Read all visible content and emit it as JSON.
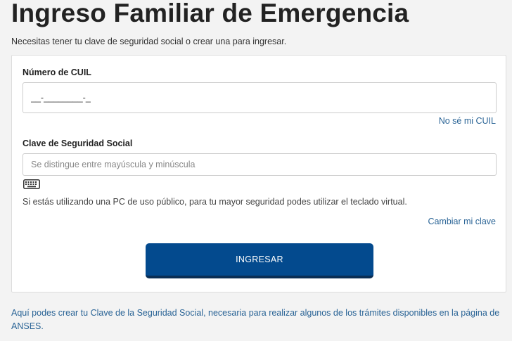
{
  "header": {
    "title": "Ingreso Familiar de Emergencia",
    "subtitle": "Necesitas tener tu clave de seguridad social o crear una para ingresar."
  },
  "form": {
    "cuil": {
      "label": "Número de CUIL",
      "value": "__-________-_",
      "help_link": "No sé mi CUIL"
    },
    "password": {
      "label": "Clave de Seguridad Social",
      "placeholder": "Se distingue entre mayúscula y minúscula",
      "keyboard_icon": "keyboard-icon",
      "note": "Si estás utilizando una PC de uso público, para tu mayor seguridad podes utilizar el teclado virtual.",
      "change_link": "Cambiar mi clave"
    },
    "submit_label": "INGRESAR"
  },
  "footer": {
    "text": "Aquí podes crear tu Clave de la Seguridad Social, necesaria para realizar algunos de los trámites disponibles en la página de ANSES."
  },
  "colors": {
    "primary_button": "#034a8e",
    "link": "#2a6496",
    "background": "#f3f3f3"
  }
}
